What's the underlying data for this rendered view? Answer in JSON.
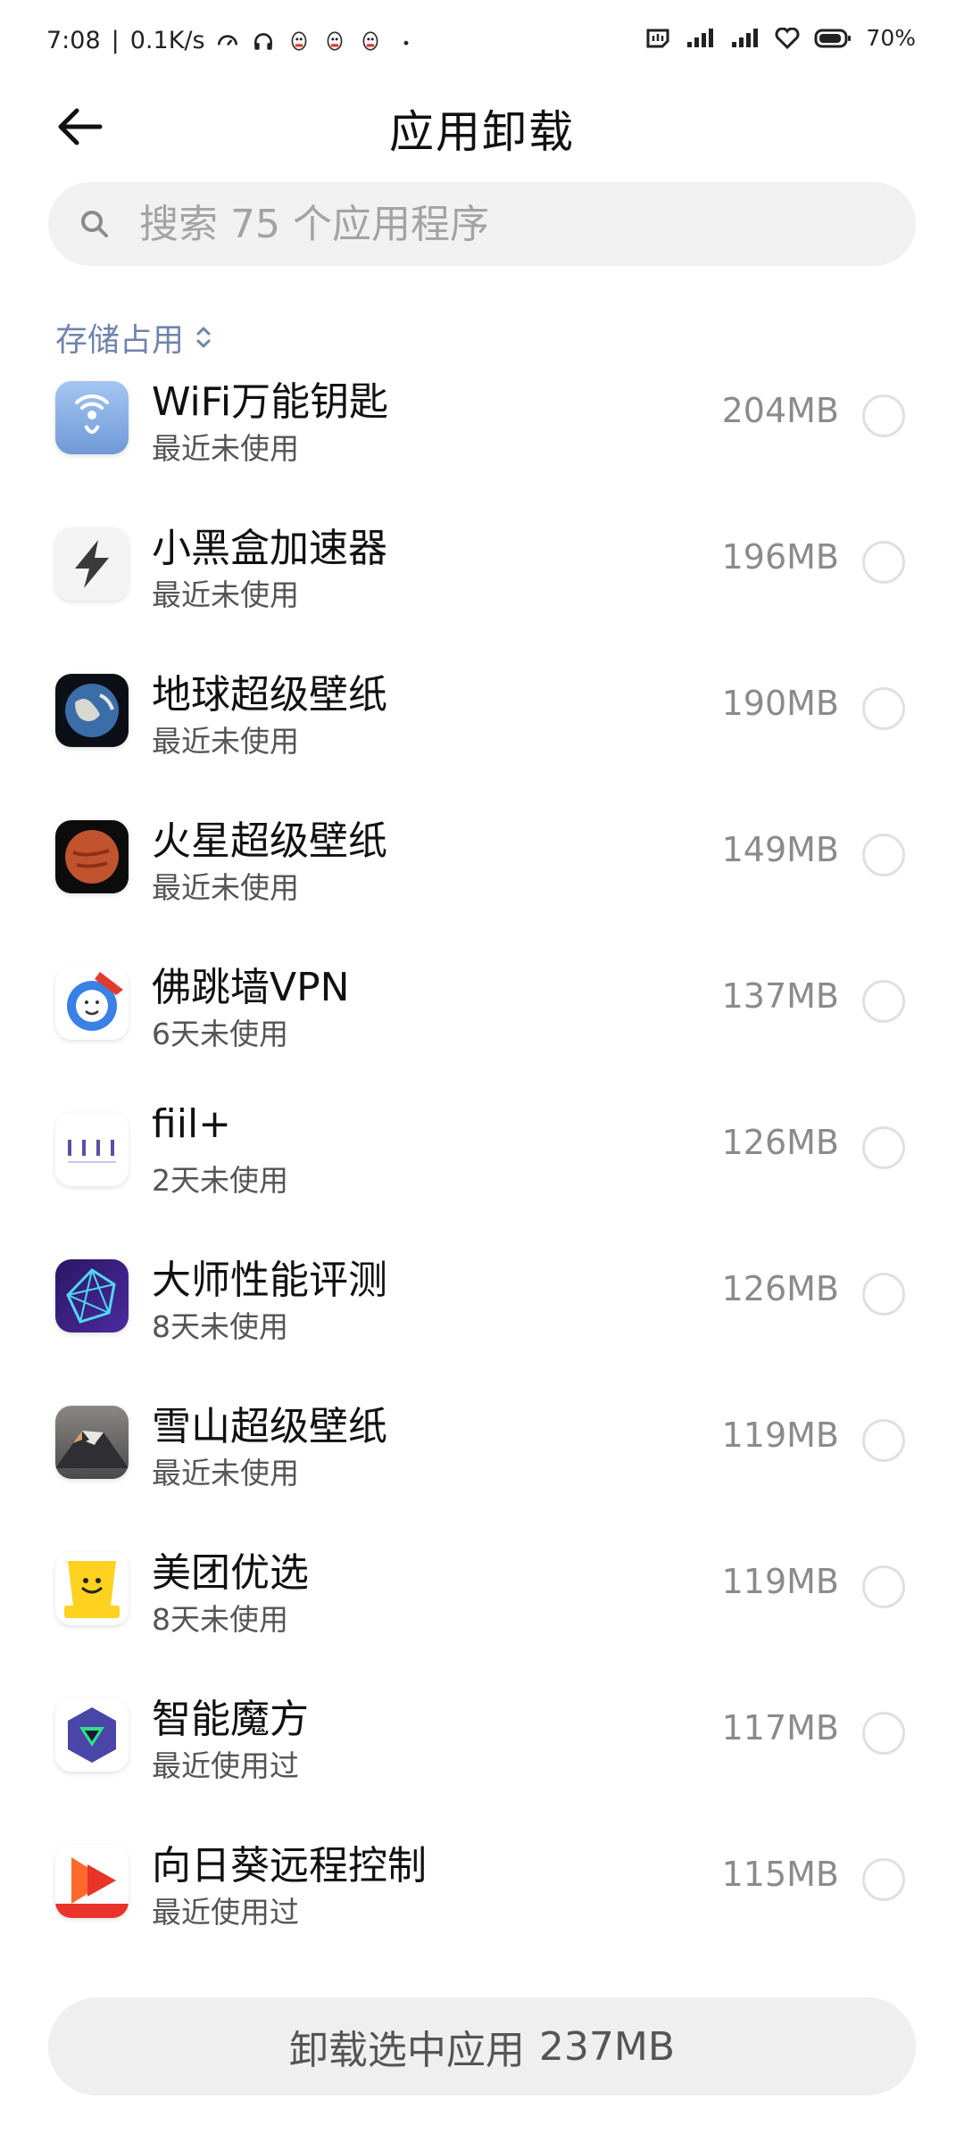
{
  "status": {
    "time": "7:08",
    "net_speed": "0.1K/s",
    "battery": "70%"
  },
  "header": {
    "title": "应用卸载"
  },
  "search": {
    "placeholder": "搜索 75 个应用程序"
  },
  "sort": {
    "label": "存储占用"
  },
  "apps": [
    {
      "name": "WiFi万能钥匙",
      "sub": "最近未使用",
      "size": "204MB",
      "icon": "wifi-master-icon",
      "color": "#8db2e6"
    },
    {
      "name": "小黑盒加速器",
      "sub": "最近未使用",
      "size": "196MB",
      "icon": "heybox-accelerator-icon",
      "color": "#f2f2f2"
    },
    {
      "name": "地球超级壁纸",
      "sub": "最近未使用",
      "size": "190MB",
      "icon": "earth-wallpaper-icon",
      "color": "#1b2a3a"
    },
    {
      "name": "火星超级壁纸",
      "sub": "最近未使用",
      "size": "149MB",
      "icon": "mars-wallpaper-icon",
      "color": "#b8432a"
    },
    {
      "name": "佛跳墙VPN",
      "sub": "6天未使用",
      "size": "137MB",
      "icon": "buddha-vpn-icon",
      "color": "#3a80e6"
    },
    {
      "name": "fiil+",
      "sub": "2天未使用",
      "size": "126MB",
      "icon": "fiil-icon",
      "color": "#ffffff"
    },
    {
      "name": "大师性能评测",
      "sub": "8天未使用",
      "size": "126MB",
      "icon": "master-benchmark-icon",
      "color": "#3b1f7a"
    },
    {
      "name": "雪山超级壁纸",
      "sub": "最近未使用",
      "size": "119MB",
      "icon": "snow-mountain-wallpaper-icon",
      "color": "#6c6a68"
    },
    {
      "name": "美团优选",
      "sub": "8天未使用",
      "size": "119MB",
      "icon": "meituan-youxuan-icon",
      "color": "#ffd21f"
    },
    {
      "name": "智能魔方",
      "sub": "最近使用过",
      "size": "117MB",
      "icon": "smart-cube-icon",
      "color": "#ffffff"
    },
    {
      "name": "向日葵远程控制",
      "sub": "最近使用过",
      "size": "115MB",
      "icon": "sunlogin-remote-icon",
      "color": "#ffffff"
    }
  ],
  "bottom": {
    "label": "卸载选中应用",
    "size": "237MB"
  }
}
